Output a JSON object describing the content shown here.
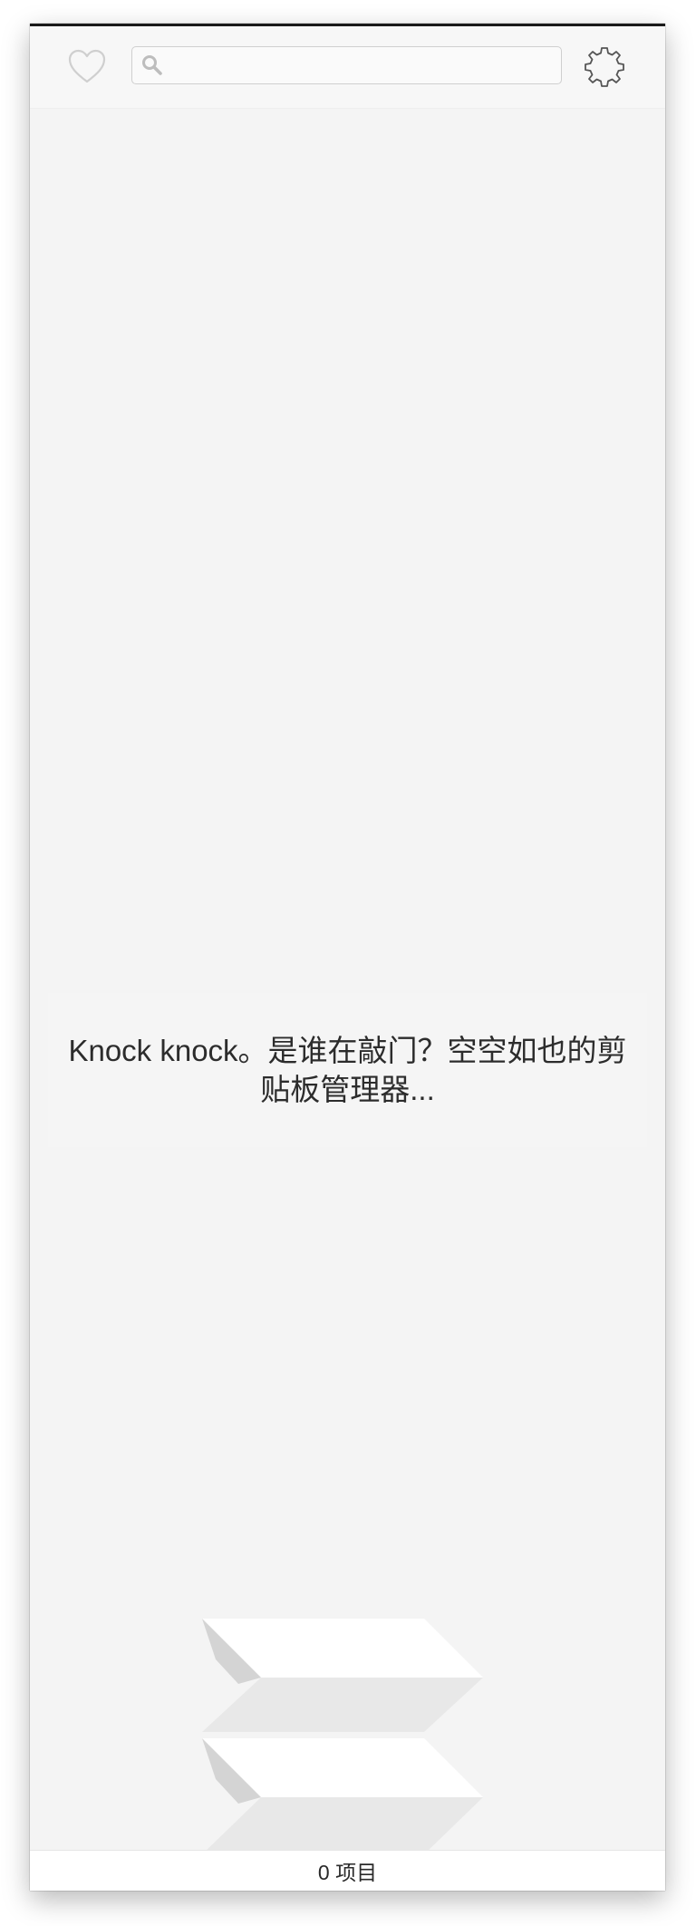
{
  "toolbar": {
    "favorite_icon": "heart-icon",
    "search": {
      "icon": "search-icon",
      "value": "",
      "placeholder": ""
    },
    "settings_icon": "gear-icon"
  },
  "content": {
    "empty_message": "Knock knock。是谁在敲门？空空如也的剪贴板管理器..."
  },
  "statusbar": {
    "item_count": "0 项目"
  },
  "colors": {
    "background": "#f4f4f4",
    "toolbar": "#f7f7f7",
    "text": "#2c2c2c",
    "icon_light": "#cfcfcf",
    "icon_dark": "#555555"
  }
}
